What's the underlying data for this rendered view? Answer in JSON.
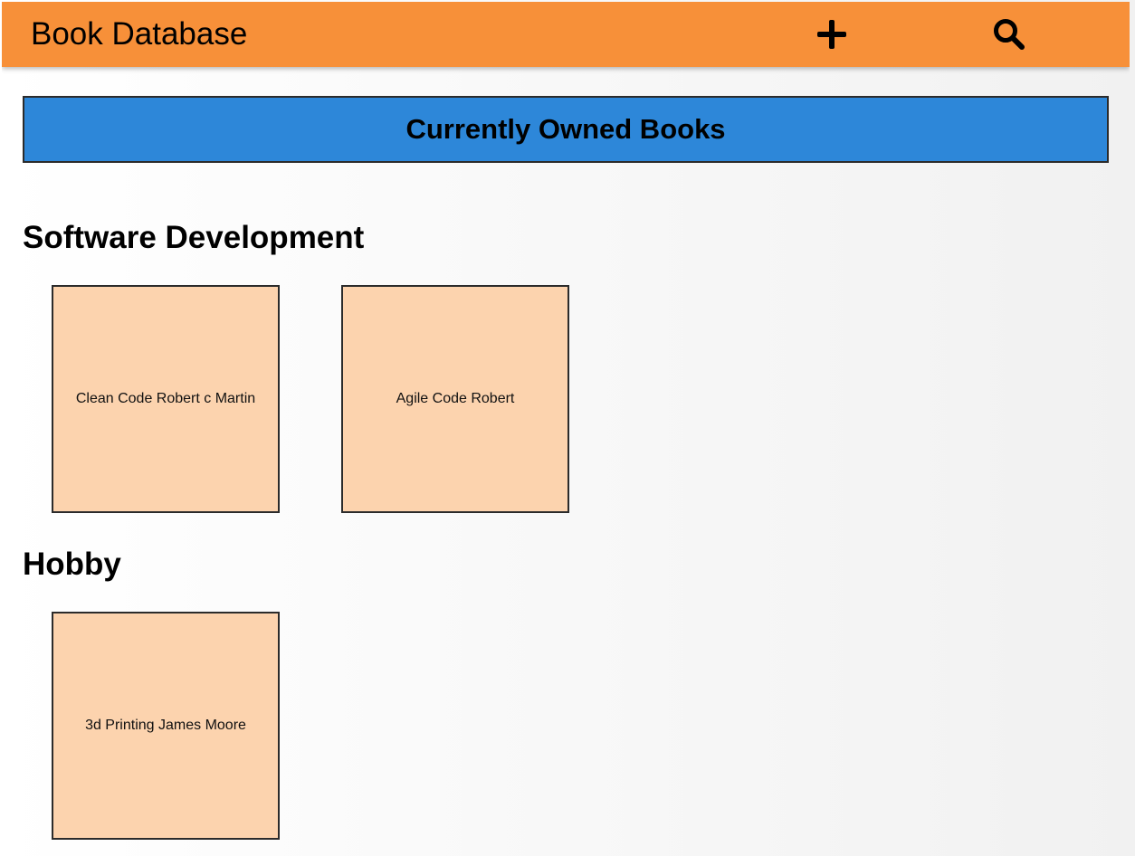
{
  "header": {
    "title": "Book Database",
    "add_icon": "plus-icon",
    "search_icon": "search-icon"
  },
  "banner": {
    "label": "Currently Owned Books"
  },
  "sections": [
    {
      "title": "Software Development",
      "books": [
        {
          "label": "Clean Code Robert c Martin"
        },
        {
          "label": "Agile Code Robert"
        }
      ]
    },
    {
      "title": "Hobby",
      "books": [
        {
          "label": "3d Printing James Moore"
        }
      ]
    }
  ],
  "colors": {
    "appbar": "#f79039",
    "banner": "#2d87d9",
    "card": "#fcd3ae",
    "border": "#2b2b2b"
  }
}
